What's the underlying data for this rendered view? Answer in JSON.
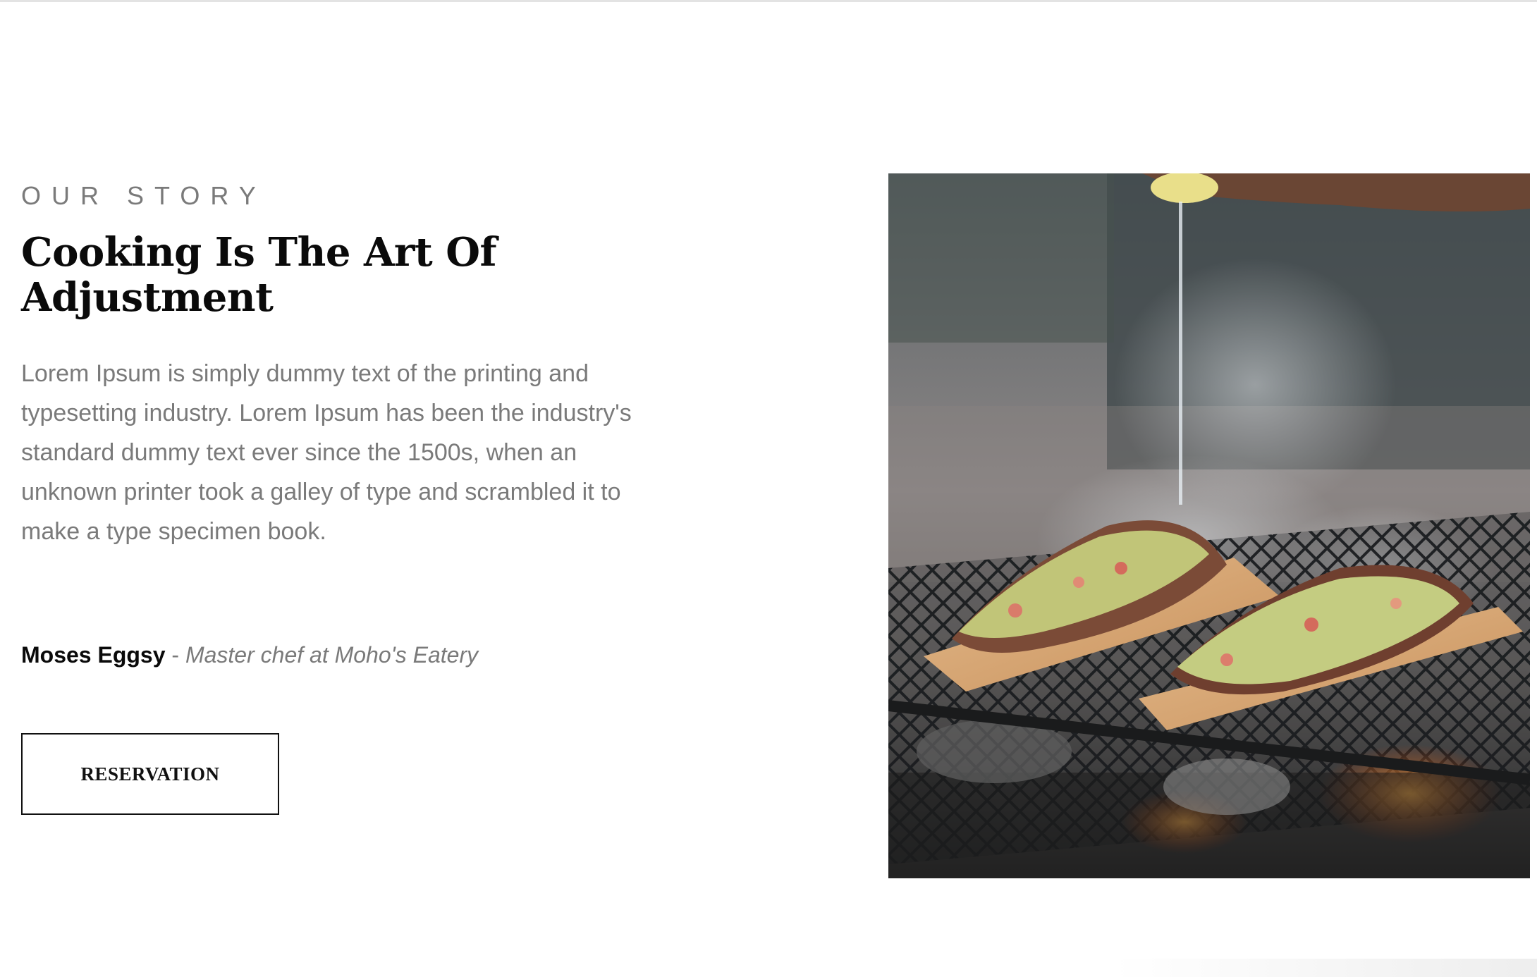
{
  "story": {
    "eyebrow": "OUR STORY",
    "title": "Cooking Is The Art Of Adjustment",
    "body": "Lorem Ipsum is simply dummy text of the printing and typesetting industry. Lorem Ipsum has been the industry's standard dummy text ever since the 1500s, when an unknown printer took a galley of type and scrambled it to make a type specimen book.",
    "signature": {
      "name": "Moses Eggsy",
      "separator": "-",
      "role": "Master chef at Moho's Eatery"
    },
    "reservation_label": "RESERVATION"
  }
}
